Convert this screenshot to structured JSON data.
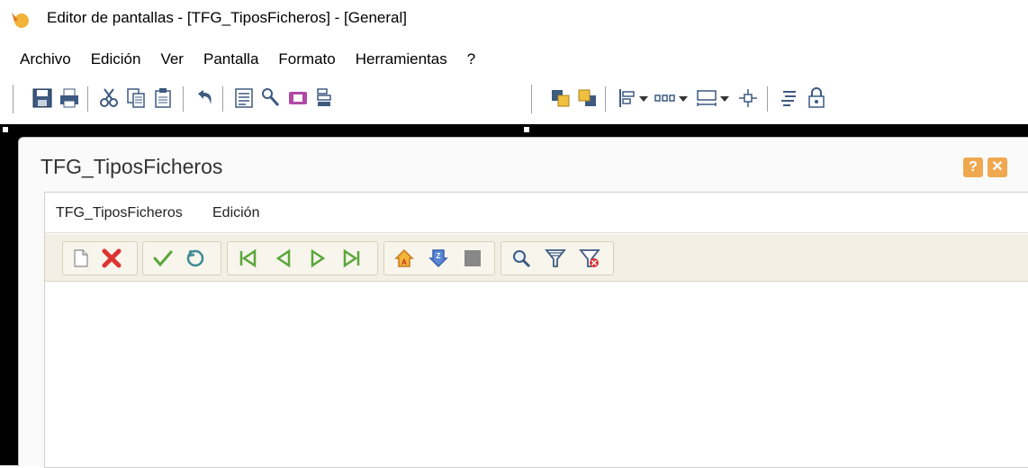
{
  "window": {
    "title": "Editor de pantallas - [TFG_TiposFicheros] - [General]"
  },
  "menubar": {
    "items": [
      "Archivo",
      "Edición",
      "Ver",
      "Pantalla",
      "Formato",
      "Herramientas",
      "?"
    ]
  },
  "toolbar": {
    "icons": [
      "save-icon",
      "print-icon",
      "cut-icon",
      "copy-icon",
      "paste-icon",
      "undo-icon",
      "properties-icon",
      "tools-icon",
      "report-icon",
      "list-icon",
      "bring-front-icon",
      "send-back-icon",
      "align-left-icon",
      "dropdown-icon",
      "distribute-horizontal-icon",
      "dropdown-icon",
      "size-icon",
      "dropdown-icon",
      "center-icon",
      "tab-order-icon",
      "lock-icon"
    ]
  },
  "form": {
    "title": "TFG_TiposFicheros",
    "help_label": "?",
    "close_label": "✕",
    "menu": {
      "item1": "TFG_TiposFicheros",
      "item2": "Edición"
    },
    "toolbar_icons": [
      "new-icon",
      "delete-icon",
      "accept-icon",
      "cancel-icon",
      "first-icon",
      "previous-icon",
      "next-icon",
      "last-icon",
      "home-icon",
      "down-icon",
      "stop-icon",
      "search-icon",
      "filter-icon",
      "clear-filter-icon"
    ]
  },
  "colors": {
    "design_background": "#000000",
    "form_toolbar_bg": "#f3efe4",
    "accent_orange": "#f0a850"
  }
}
